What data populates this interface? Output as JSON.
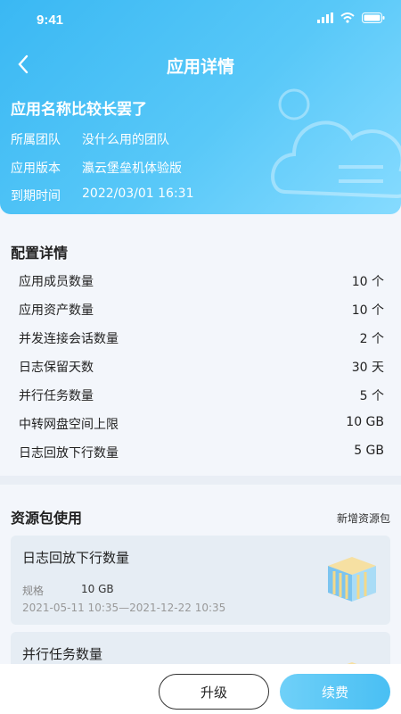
{
  "status": {
    "time": "9:41"
  },
  "header": {
    "title": "应用详情"
  },
  "app": {
    "name": "应用名称比较长罢了",
    "info": [
      {
        "label": "所属团队",
        "value": "没什么用的团队"
      },
      {
        "label": "应用版本",
        "value": "瀛云堡垒机体验版"
      },
      {
        "label": "到期时间",
        "value": "2022/03/01 16:31"
      }
    ]
  },
  "config": {
    "title": "配置详情",
    "rows": [
      {
        "label": "应用成员数量",
        "value": "10 个"
      },
      {
        "label": "应用资产数量",
        "value": "10 个"
      },
      {
        "label": "并发连接会话数量",
        "value": "2 个"
      },
      {
        "label": "日志保留天数",
        "value": "30 天"
      },
      {
        "label": "并行任务数量",
        "value": "5 个"
      },
      {
        "label": "中转网盘空间上限",
        "value": "10 GB"
      },
      {
        "label": "日志回放下行数量",
        "value": "5 GB"
      }
    ]
  },
  "resources": {
    "title": "资源包使用",
    "add_label": "新增资源包",
    "cards": [
      {
        "title": "日志回放下行数量",
        "spec_label": "规格",
        "spec_value": "10 GB",
        "period": "2021-05-11 10:35—2021-12-22 10:35"
      },
      {
        "title": "并行任务数量"
      }
    ]
  },
  "actions": {
    "upgrade_label": "升级",
    "renew_label": "续费"
  },
  "colors": {
    "primary": "#3ab8f3",
    "primary_light": "#86dbff",
    "card_bg": "#e6edf4"
  }
}
